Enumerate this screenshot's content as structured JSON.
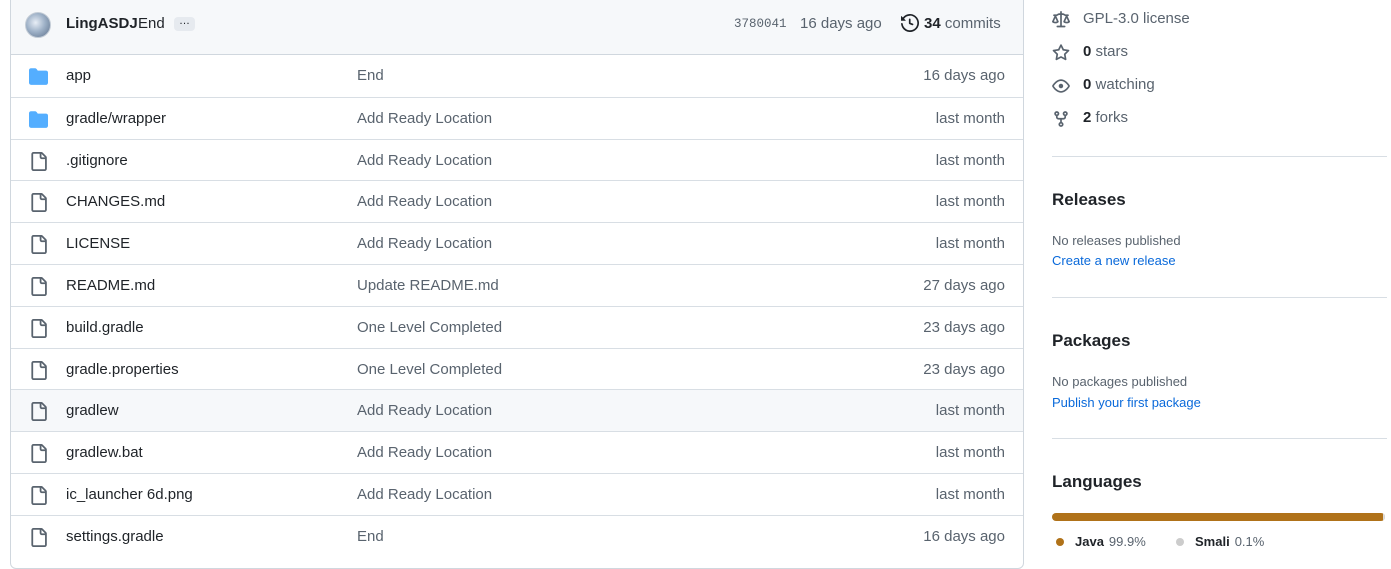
{
  "commit": {
    "author": "LingASDJ",
    "message": "End",
    "ellipsis": "…",
    "sha": "3780041",
    "age": "16 days ago",
    "count": "34",
    "count_label": "commits",
    "avatar_icon": "user-avatar",
    "history_icon": "history-icon"
  },
  "files": [
    {
      "name": "app",
      "type": "folder",
      "message": "End",
      "age": "16 days ago"
    },
    {
      "name": "gradle/wrapper",
      "type": "folder",
      "message": "Add Ready Location",
      "age": "last month"
    },
    {
      "name": ".gitignore",
      "type": "file",
      "message": "Add Ready Location",
      "age": "last month"
    },
    {
      "name": "CHANGES.md",
      "type": "file",
      "message": "Add Ready Location",
      "age": "last month"
    },
    {
      "name": "LICENSE",
      "type": "file",
      "message": "Add Ready Location",
      "age": "last month"
    },
    {
      "name": "README.md",
      "type": "file",
      "message": "Update README.md",
      "age": "27 days ago"
    },
    {
      "name": "build.gradle",
      "type": "file",
      "message": "One Level Completed",
      "age": "23 days ago"
    },
    {
      "name": "gradle.properties",
      "type": "file",
      "message": "One Level Completed",
      "age": "23 days ago"
    },
    {
      "name": "gradlew",
      "type": "file",
      "message": "Add Ready Location",
      "age": "last month"
    },
    {
      "name": "gradlew.bat",
      "type": "file",
      "message": "Add Ready Location",
      "age": "last month"
    },
    {
      "name": "ic_launcher 6d.png",
      "type": "file",
      "message": "Add Ready Location",
      "age": "last month"
    },
    {
      "name": "settings.gradle",
      "type": "file",
      "message": "End",
      "age": "16 days ago"
    }
  ],
  "about": {
    "license": "GPL-3.0 license",
    "stars_count": "0",
    "stars_label": "stars",
    "watching_count": "0",
    "watching_label": "watching",
    "forks_count": "2",
    "forks_label": "forks"
  },
  "releases": {
    "title": "Releases",
    "empty": "No releases published",
    "link": "Create a new release"
  },
  "packages": {
    "title": "Packages",
    "empty": "No packages published",
    "link": "Publish your first package"
  },
  "languages": {
    "title": "Languages",
    "items": [
      {
        "name": "Java",
        "percent": "99.9%",
        "color": "#b07219"
      },
      {
        "name": "Smali",
        "percent": "0.1%",
        "color": "#cccccc"
      }
    ]
  },
  "colors": {
    "folder": "#54aeff",
    "link": "#0969da",
    "muted": "#59636e"
  }
}
